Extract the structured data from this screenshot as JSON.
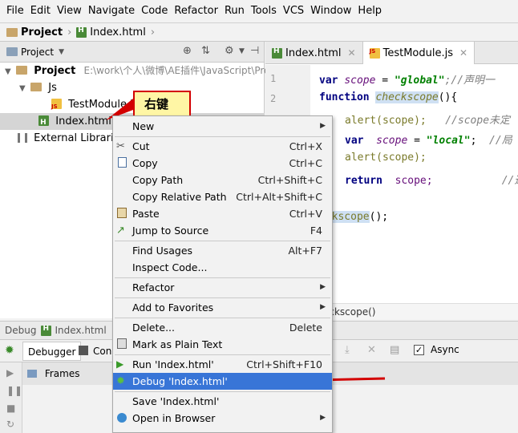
{
  "menubar": [
    "File",
    "Edit",
    "View",
    "Navigate",
    "Code",
    "Refactor",
    "Run",
    "Tools",
    "VCS",
    "Window",
    "Help"
  ],
  "breadcrumb": {
    "project": "Project",
    "file": "Index.html"
  },
  "project_panel": {
    "dropdown_label": "Project",
    "tree": [
      {
        "label": "Project",
        "path": "E:\\work\\个人\\微博\\AE插件\\JavaScript\\Proj"
      },
      {
        "label": "Js"
      },
      {
        "label": "TestModule.js"
      },
      {
        "label": "Index.html"
      },
      {
        "label": "External Libraries"
      }
    ]
  },
  "editor": {
    "tabs": [
      "Index.html",
      "TestModule.js"
    ],
    "line_numbers": [
      "1",
      "2"
    ],
    "code": {
      "l1_a": "var",
      "l1_b": "scope",
      "l1_c": " = ",
      "l1_d": "\"global\"",
      "l1_e": ";//声明一",
      "l2_a": "function",
      "l2_b": "checkscope",
      "l2_c": "(){",
      "l3_a": "alert(scope);",
      "l3_b": "//scope未定",
      "l4_a": "var",
      "l4_b": "scope",
      "l4_c": " = ",
      "l4_d": "\"local\"",
      "l4_e": ";",
      "l4_f": "//局",
      "l5_a": "alert(scope);",
      "l6_a": "return",
      "l6_b": "scope;",
      "l6_c": "//返",
      "l8_a": "eckscope",
      "l8_b": "();"
    },
    "footer_crumb": "eckscope()"
  },
  "callout": {
    "text": "右键"
  },
  "context_menu": {
    "items": [
      {
        "label": "New",
        "shortcut": ""
      },
      {
        "label": "Cut",
        "shortcut": "Ctrl+X"
      },
      {
        "label": "Copy",
        "shortcut": "Ctrl+C"
      },
      {
        "label": "Copy Path",
        "shortcut": "Ctrl+Shift+C"
      },
      {
        "label": "Copy Relative Path",
        "shortcut": "Ctrl+Alt+Shift+C"
      },
      {
        "label": "Paste",
        "shortcut": "Ctrl+V"
      },
      {
        "label": "Jump to Source",
        "shortcut": "F4"
      },
      {
        "label": "Find Usages",
        "shortcut": "Alt+F7"
      },
      {
        "label": "Inspect Code...",
        "shortcut": ""
      },
      {
        "label": "Refactor",
        "shortcut": ""
      },
      {
        "label": "Add to Favorites",
        "shortcut": ""
      },
      {
        "label": "Delete...",
        "shortcut": "Delete"
      },
      {
        "label": "Mark as Plain Text",
        "shortcut": ""
      },
      {
        "label": "Run 'Index.html'",
        "shortcut": "Ctrl+Shift+F10"
      },
      {
        "label": "Debug 'Index.html'",
        "shortcut": ""
      },
      {
        "label": "Save 'Index.html'",
        "shortcut": ""
      },
      {
        "label": "Open in Browser",
        "shortcut": ""
      }
    ]
  },
  "debug": {
    "title": "Debug",
    "file": "Index.html",
    "tabs": [
      "Debugger",
      "Cons"
    ],
    "frames": "Frames",
    "async": "Async"
  },
  "colors": {
    "selection": "#3875d7",
    "callout_bg": "#fff6a5",
    "arrow": "#d30000"
  }
}
